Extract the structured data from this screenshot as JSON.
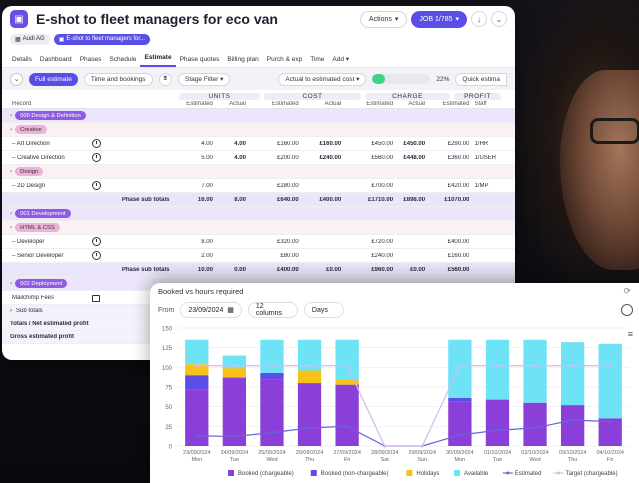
{
  "window": {
    "title": "E-shot to fleet managers for eco van",
    "actions_label": "Actions",
    "job_label": "JOB 1/785",
    "client_chip": "Audi AG",
    "job_chip": "E-shot to fleet managers for..."
  },
  "tabs": [
    "Details",
    "Dashboard",
    "Phases",
    "Schedule",
    "Estimate",
    "Phase quotes",
    "Billing plan",
    "Purch & exp",
    "Time",
    "Add"
  ],
  "active_tab": "Estimate",
  "toolbar": {
    "full_estimate": "Full estimate",
    "time_and_bookings": "Time and bookings",
    "stage_filter": "Stage Filter",
    "actual_vs_estimated": "Actual to estimated cost",
    "progress_pct": 22,
    "progress_label": "22%",
    "quick_estimate": "Quick estima"
  },
  "groups": {
    "units": "UNITS",
    "cost": "COST",
    "charge": "CHARGE",
    "profit": "PROFIT"
  },
  "subheaders": {
    "record": "Record",
    "estimated": "Estimated",
    "actual": "Actual",
    "staff": "Staff"
  },
  "rows": [
    {
      "kind": "phase",
      "label": "000 Design & Definition"
    },
    {
      "kind": "task",
      "label": "Creative"
    },
    {
      "kind": "line",
      "name": "Art Direction",
      "clock": true,
      "ue": "4.00",
      "ua": "4.00",
      "ce": "£160.00",
      "ca": "£160.00",
      "he": "£450.00",
      "ha": "£450.00",
      "pe": "£290.00",
      "st": "1/HR"
    },
    {
      "kind": "line",
      "name": "Creative Direction",
      "clock": true,
      "ue": "5.00",
      "ua": "4.00",
      "ce": "£200.00",
      "ca": "£240.00",
      "he": "£560.00",
      "ha": "£448.00",
      "pe": "£360.00",
      "st": "1/USER"
    },
    {
      "kind": "task",
      "label": "Design"
    },
    {
      "kind": "line",
      "name": "2D Design",
      "clock": true,
      "ue": "7.00",
      "ua": "",
      "ce": "£280.00",
      "ca": "",
      "he": "£700.00",
      "ha": "",
      "pe": "£420.00",
      "st": "1/MP"
    },
    {
      "kind": "subtotal",
      "name": "Phase sub totals",
      "ue": "16.00",
      "ua": "8.00",
      "ce": "£640.00",
      "ca": "£400.00",
      "he": "£1710.00",
      "ha": "£898.00",
      "pe": "£1070.00",
      "st": ""
    },
    {
      "kind": "phase",
      "label": "001 Development"
    },
    {
      "kind": "task",
      "label": "HTML & CSS"
    },
    {
      "kind": "line",
      "name": "Developer",
      "clock": true,
      "ue": "8.00",
      "ua": "",
      "ce": "£320.00",
      "ca": "",
      "he": "£720.00",
      "ha": "",
      "pe": "£400.00",
      "st": ""
    },
    {
      "kind": "line",
      "name": "Senior Developer",
      "clock": true,
      "ue": "2.00",
      "ua": "",
      "ce": "£80.00",
      "ca": "",
      "he": "£240.00",
      "ha": "",
      "pe": "£160.00",
      "st": ""
    },
    {
      "kind": "subtotal",
      "name": "Phase sub totals",
      "ue": "10.00",
      "ua": "0.00",
      "ce": "£400.00",
      "ca": "£0.00",
      "he": "£960.00",
      "ha": "£0.00",
      "pe": "£560.00",
      "st": ""
    },
    {
      "kind": "phase",
      "label": "002 Deployment"
    },
    {
      "kind": "line",
      "name": "Mailchimp Fees",
      "bag": true,
      "ue": "",
      "ua": "",
      "ce": "",
      "ca": "",
      "he": "",
      "ha": "",
      "pe": "",
      "st": ""
    }
  ],
  "footer": {
    "sub_totals": "Sub totals",
    "totals": "Totals / Net estimated profit",
    "gross": "Gross estimated profit"
  },
  "chart_panel": {
    "title": "Booked vs hours required",
    "from_label": "From",
    "from_value": "23/09/2024",
    "columns": "12 columns",
    "unit": "Days"
  },
  "chart_data": {
    "type": "bar",
    "ylim": [
      0,
      150
    ],
    "yticks": [
      0,
      25,
      50,
      75,
      100,
      125,
      150
    ],
    "categories": [
      "23/09/2024 Mon",
      "24/09/2024 Tue",
      "25/09/2024 Wed",
      "26/09/2024 Thu",
      "27/09/2024 Fri",
      "28/09/2024 Sat",
      "29/09/2024 Sun",
      "30/09/2024 Mon",
      "01/10/2024 Tue",
      "02/10/2024 Wed",
      "03/10/2024 Thu",
      "04/10/2024 Fri"
    ],
    "series": [
      {
        "name": "Booked (chargeable)",
        "color": "#8b3fd9",
        "values": [
          72,
          87,
          85,
          80,
          78,
          0,
          0,
          57,
          59,
          55,
          52,
          35
        ]
      },
      {
        "name": "Booked (non-chargeable)",
        "color": "#5b4ee8",
        "values": [
          18,
          0,
          8,
          0,
          0,
          0,
          0,
          4,
          0,
          0,
          0,
          0
        ]
      },
      {
        "name": "Holidays",
        "color": "#f6c21a",
        "values": [
          14,
          12,
          0,
          16,
          7,
          0,
          0,
          0,
          0,
          0,
          0,
          0
        ]
      },
      {
        "name": "Available",
        "color": "#6de3f5",
        "values": [
          31,
          16,
          42,
          39,
          50,
          0,
          0,
          74,
          76,
          80,
          80,
          95
        ]
      }
    ],
    "lines": [
      {
        "name": "Estimated",
        "color": "#6a62d8",
        "values": [
          13,
          12,
          17,
          23,
          25,
          0,
          0,
          14,
          20,
          23,
          33,
          31
        ]
      },
      {
        "name": "Target (chargeable)",
        "color": "#d6b8f2",
        "values": [
          102,
          102,
          102,
          102,
          102,
          0,
          0,
          102,
          102,
          102,
          102,
          102
        ]
      }
    ]
  },
  "colors": {
    "accent": "#5b4ee8",
    "phase": "#8e5ce0",
    "task": "#e7b6d6"
  }
}
